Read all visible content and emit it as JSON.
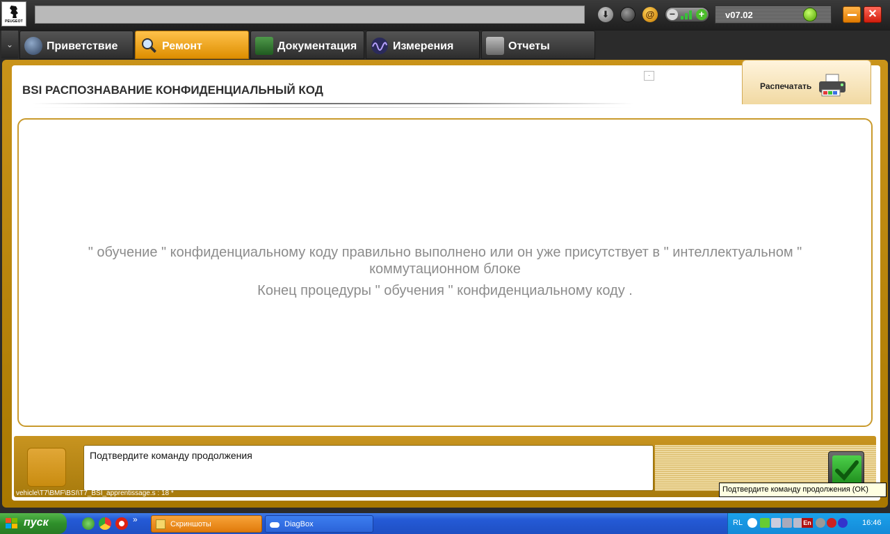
{
  "topbar": {
    "logo_text": "PEUGEOT",
    "version": "v07.02",
    "icons": [
      "download-icon",
      "user-icon",
      "at-icon",
      "signal-icon",
      "status-led-icon",
      "minimize-icon",
      "close-icon"
    ]
  },
  "tabs": [
    {
      "label": "Приветствие",
      "icon": "globe-icon",
      "active": false
    },
    {
      "label": "Ремонт",
      "icon": "magnifier-icon",
      "active": true
    },
    {
      "label": "Документация",
      "icon": "book-icon",
      "active": false
    },
    {
      "label": "Измерения",
      "icon": "waveform-icon",
      "active": false
    },
    {
      "label": "Отчеты",
      "icon": "report-icon",
      "active": false
    }
  ],
  "panel": {
    "title": "BSI  РАСПОЗНАВАНИЕ КОНФИДЕНЦИАЛЬНЫЙ КОД",
    "print_label": "Распечатать",
    "message_line1": "\" обучение \" конфиденциальному коду правильно выполнено или он уже присутствует в \" интеллектуальном \"",
    "message_line2": "коммутационном блоке",
    "message_line3": "Конец процедуры \" обучения \" конфиденциальному коду ."
  },
  "bottom": {
    "prompt": "Подтвердите команду продолжения",
    "path": "vehicle\\T7\\BMF\\BSI\\T7_BSI_apprentissage.s : 18 *",
    "tooltip": "Подтвердите команду продолжения (OK)"
  },
  "taskbar": {
    "start_label": "пуск",
    "tasks": [
      "Скриншоты",
      "DiagBox"
    ],
    "lang": "RL",
    "tray_lang": "En",
    "clock": "16:46"
  },
  "colors": {
    "accent": "#dd8e00",
    "frame": "#b98612",
    "message": "#8c8c8c",
    "taskbar": "#245ad6"
  }
}
